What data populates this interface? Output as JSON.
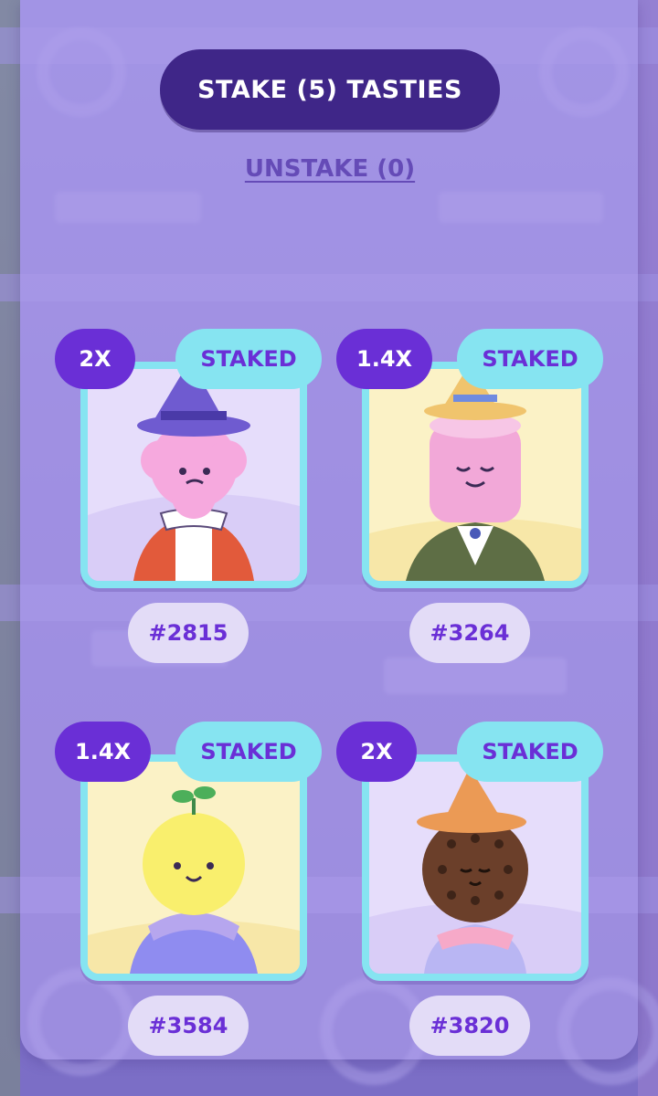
{
  "header": {
    "stake_button_label": "STAKE (5) TASTIES",
    "unstake_link_label": "UNSTAKE (0)"
  },
  "cards": [
    {
      "multiplier": "2X",
      "status": "STAKED",
      "token_id": "#2815",
      "character": "pink cotton-candy wizard with hat and red cape"
    },
    {
      "multiplier": "1.4X",
      "status": "STAKED",
      "token_id": "#3264",
      "character": "marshmallow with wizard hat and green suit"
    },
    {
      "multiplier": "1.4X",
      "status": "STAKED",
      "token_id": "#3584",
      "character": "yellow lemon with sprout and blue coat"
    },
    {
      "multiplier": "2X",
      "status": "STAKED",
      "token_id": "#3820",
      "character": "chocolate cookie with orange wizard hat"
    }
  ],
  "colors": {
    "primary_dark": "#3f2688",
    "accent_purple": "#6a2fd6",
    "accent_cyan": "#86e4f1",
    "pill_light": "#e3dcf7"
  }
}
